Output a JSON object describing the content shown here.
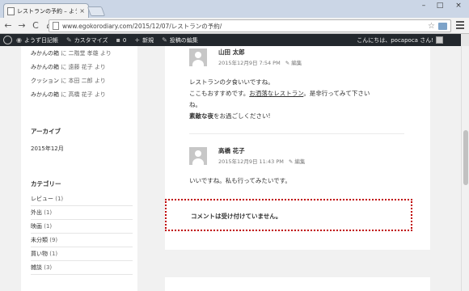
{
  "browser": {
    "tab_title": "レストランの予約 – ようず日記",
    "tab_close": "×",
    "url": "www.egokorodiary.com/2015/12/07/レストランの予約/",
    "win_minimize": "–",
    "win_maximize": "□",
    "win_close": "×",
    "back": "←",
    "forward": "→",
    "reload": "C",
    "home": "⌂",
    "star": "☆"
  },
  "adminbar": {
    "site_name": "ようず日記帳",
    "customize": "カスタマイズ",
    "comments_count": "0",
    "new": "新規",
    "edit_post": "投稿の編集",
    "greeting": "こんにちは、pocapoca さん!"
  },
  "sidebar": {
    "recent_comments": [
      {
        "author": "みかんの箱",
        "sep": " に ",
        "who": "二階堂 孝雄 より"
      },
      {
        "author": "みかんの箱",
        "sep": " に ",
        "who": "遠藤 花子 より"
      },
      {
        "author": "クッション",
        "sep": " に ",
        "who": "本田 二郎 より"
      },
      {
        "author": "みかんの箱",
        "sep": " に ",
        "who": "高橋 花子 より"
      }
    ],
    "archives_heading": "アーカイブ",
    "archives": [
      "2015年12月"
    ],
    "categories_heading": "カテゴリー",
    "categories": [
      {
        "name": "レビュー",
        "count": "(1)"
      },
      {
        "name": "外出",
        "count": "(1)"
      },
      {
        "name": "映画",
        "count": "(1)"
      },
      {
        "name": "未分類",
        "count": "(9)"
      },
      {
        "name": "買い物",
        "count": "(1)"
      },
      {
        "name": "雑談",
        "count": "(3)"
      }
    ]
  },
  "comments": [
    {
      "author": "山田 太郎",
      "date": "2015年12月9日 7:54 PM",
      "edit": "✎ 編集",
      "line1": "レストランの夕食いいですね。",
      "line2_pre": "ここもおすすめです。",
      "line2_link": "お洒落なレストラン",
      "line2_post": "。是非行ってみて下さい",
      "line3": "ね。",
      "line4_bold": "素敵な夜",
      "line4_post": "をお過ごしください!"
    },
    {
      "author": "高橋 花子",
      "date": "2015年12月9日 11:43 PM",
      "edit": "✎ 編集",
      "line1": "いいですね。私も行ってみたいです。"
    }
  ],
  "comments_closed": "コメントは受け付けていません。"
}
